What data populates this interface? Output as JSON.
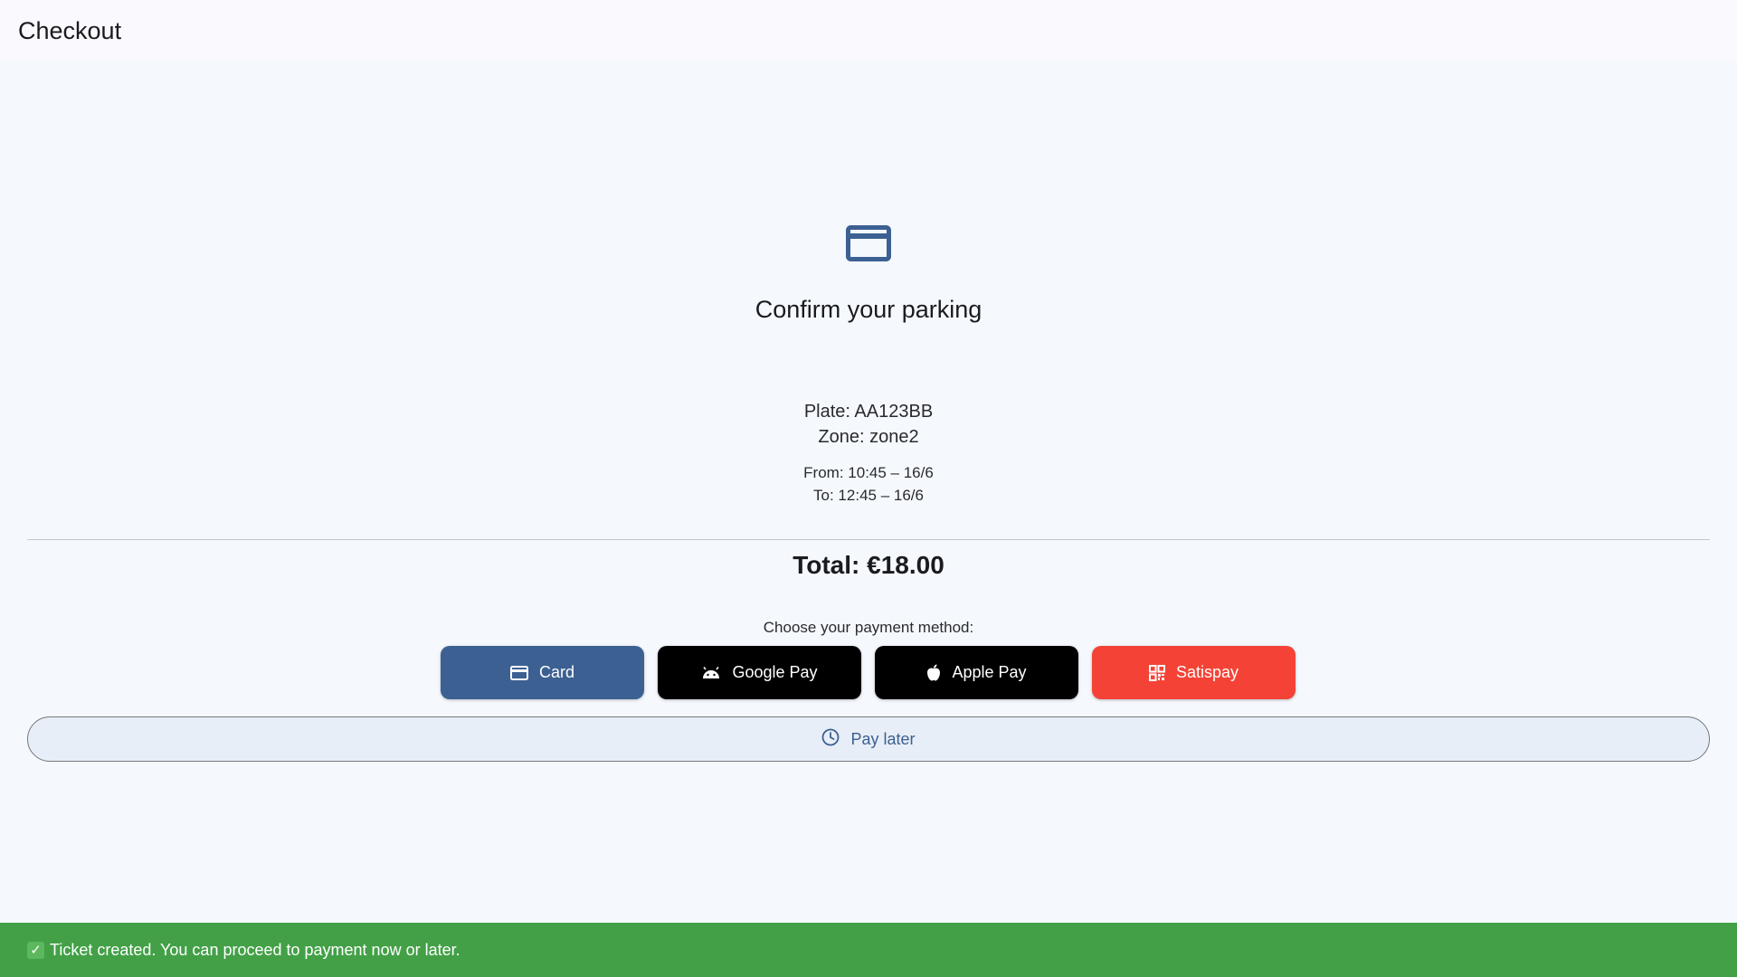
{
  "appbar": {
    "title": "Checkout"
  },
  "summary": {
    "icon": "credit-card-icon",
    "title": "Confirm your parking",
    "plate": "Plate: AA123BB",
    "zone": "Zone: zone2",
    "from": "From: 10:45 – 16/6",
    "to": "To: 12:45 – 16/6",
    "total": "Total: €18.00"
  },
  "payment": {
    "prompt": "Choose your payment method:",
    "methods": [
      {
        "label": "Card",
        "icon": "credit-card-icon",
        "color": "#3c6092"
      },
      {
        "label": "Google Pay",
        "icon": "android-icon",
        "color": "#000000"
      },
      {
        "label": "Apple Pay",
        "icon": "apple-icon",
        "color": "#000000"
      },
      {
        "label": "Satispay",
        "icon": "qr-code-icon",
        "color": "#f44336"
      }
    ],
    "pay_later": {
      "label": "Pay later",
      "icon": "clock-icon"
    }
  },
  "snackbar": {
    "icon": "check-mark-icon",
    "message": "Ticket created. You can proceed to payment now or later."
  },
  "colors": {
    "primary": "#3c6092",
    "success": "#43a047",
    "background": "#f5f9fe"
  }
}
